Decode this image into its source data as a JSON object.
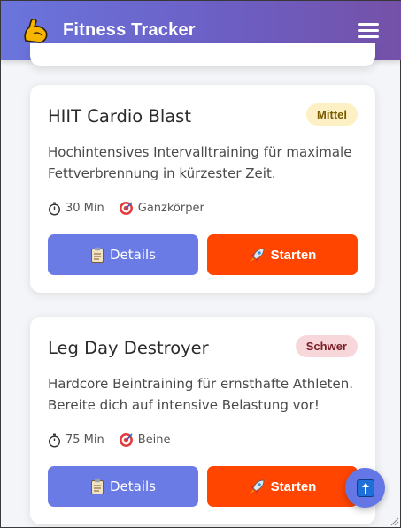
{
  "header": {
    "title": "Fitness Tracker",
    "logo_icon": "flexed-biceps-icon",
    "menu_icon": "hamburger-menu-icon"
  },
  "workouts": [
    {
      "title": "HIIT Cardio Blast",
      "difficulty": "Mittel",
      "description": "Hochintensives Intervalltraining für maximale Fettverbrennung in kürzester Zeit.",
      "duration": "30 Min",
      "target": "Ganzkörper",
      "details_label": "Details",
      "start_label": "Starten"
    },
    {
      "title": "Leg Day Destroyer",
      "difficulty": "Schwer",
      "description": "Hardcore Beintraining für ernsthafte Athleten. Bereite dich auf intensive Belastung vor!",
      "duration": "75 Min",
      "target": "Beine",
      "details_label": "Details",
      "start_label": "Starten"
    }
  ],
  "colors": {
    "header_start": "#6a75dd",
    "header_end": "#7451a8",
    "details_button": "#6a7be6",
    "start_button": "#ff4500",
    "badge_mittel": "#fdf0c4",
    "badge_schwer": "#f7d7da"
  },
  "scroll_top_icon": "arrow-up-icon"
}
